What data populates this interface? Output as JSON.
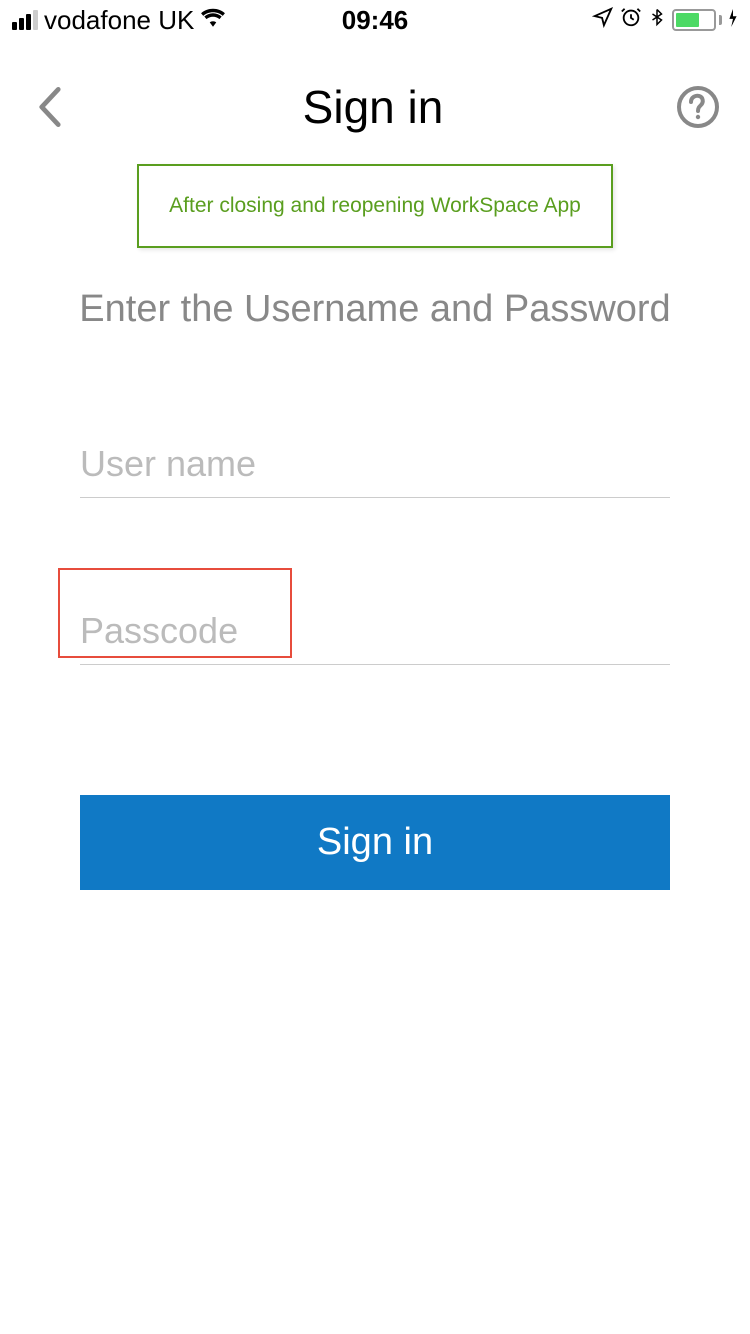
{
  "status_bar": {
    "carrier": "vodafone UK",
    "time": "09:46"
  },
  "header": {
    "title": "Sign in"
  },
  "banner": {
    "text": "After closing and reopening WorkSpace App"
  },
  "subtitle": "Enter the Username and Password",
  "form": {
    "username_placeholder": "User name",
    "username_value": "",
    "passcode_placeholder": "Passcode",
    "passcode_value": "",
    "signin_button": "Sign in"
  }
}
